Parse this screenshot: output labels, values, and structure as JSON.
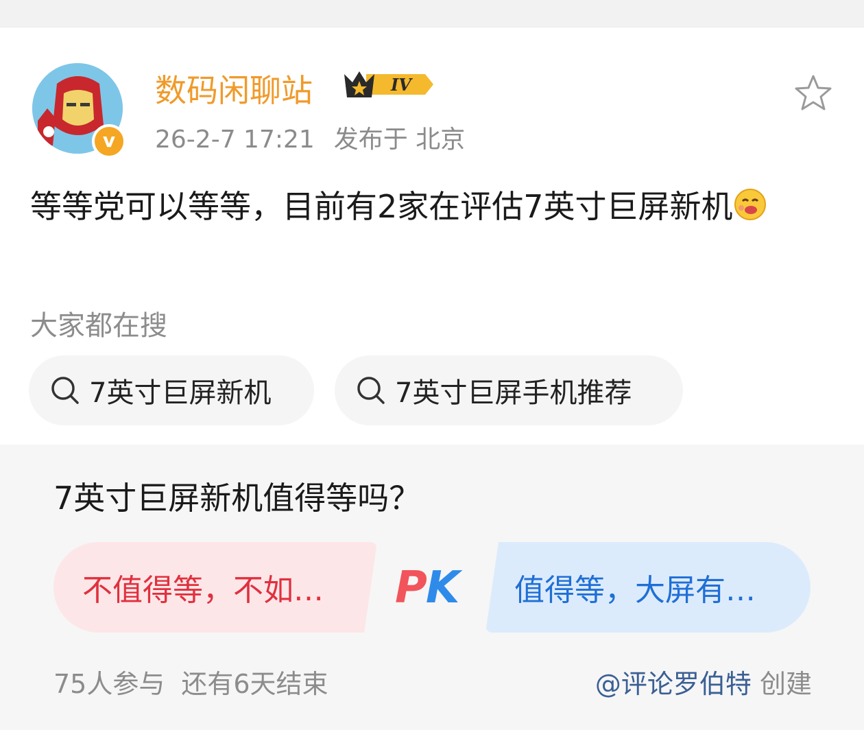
{
  "post": {
    "author": "数码闲聊站",
    "vip_level": "IV",
    "time": "26-2-7 17:21",
    "location": "发布于 北京",
    "text": "等等党可以等等，目前有2家在评估7英寸巨屏新机"
  },
  "search": {
    "label": "大家都在搜",
    "chips": [
      "7英寸巨屏新机",
      "7英寸巨屏手机推荐"
    ]
  },
  "poll": {
    "question": "7英寸巨屏新机值得等吗？",
    "option_left": "不值得等，不如…",
    "option_right": "值得等，大屏有…",
    "pk_p": "P",
    "pk_k": "K",
    "participants": "75人参与",
    "remaining": "还有6天结束",
    "creator": "@评论罗伯特",
    "creator_suffix": " 创建"
  },
  "colors": {
    "author": "#f09a2a",
    "option_left_text": "#e0303e",
    "option_right_text": "#1f6fd6",
    "accent_vip": "#f5a623"
  },
  "icons": {
    "star": "star-outline-icon",
    "search": "search-icon",
    "verified": "verified-v-icon",
    "emoji": "drooling-face-emoji"
  }
}
